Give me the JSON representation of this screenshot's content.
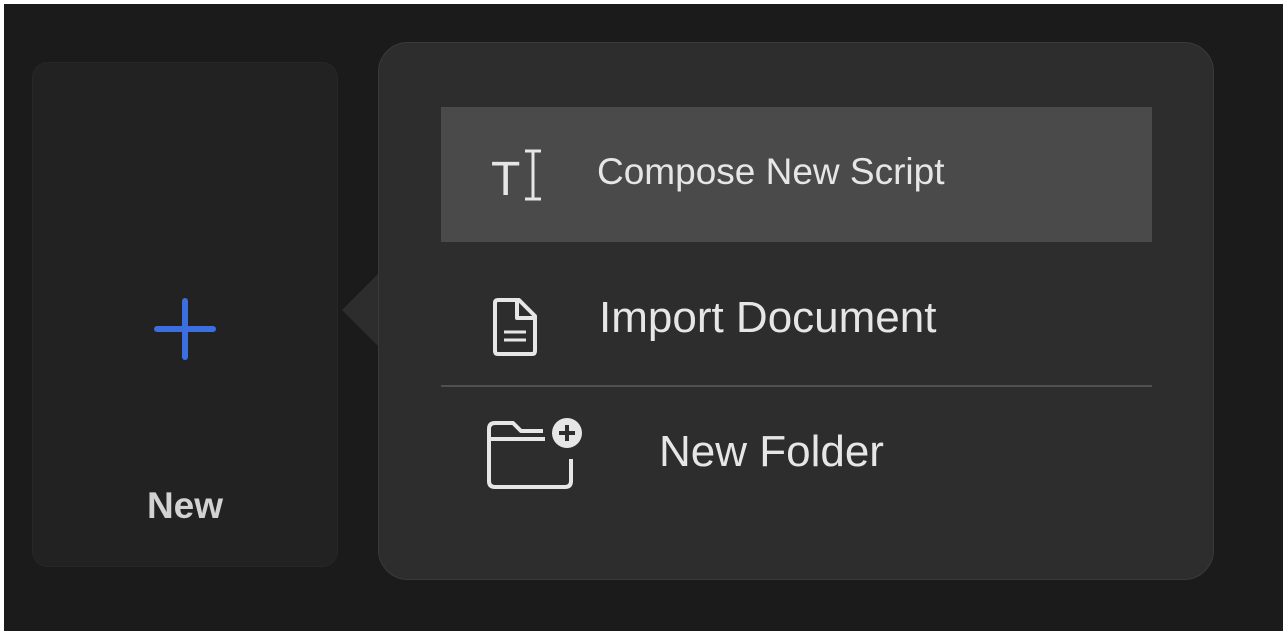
{
  "new_tile": {
    "label": "New",
    "icon": "plus-icon",
    "accent_color": "#3b6fe0"
  },
  "menu": {
    "items": [
      {
        "label": "Compose New Script",
        "icon": "text-cursor-icon",
        "highlighted": true
      },
      {
        "label": "Import Document",
        "icon": "document-icon",
        "highlighted": false
      },
      {
        "label": "New Folder",
        "icon": "folder-add-icon",
        "highlighted": false
      }
    ]
  },
  "colors": {
    "background": "#1b1b1b",
    "menu_background": "#2d2d2d",
    "highlight": "#4a4a4a",
    "text": "#e6e6e6"
  }
}
